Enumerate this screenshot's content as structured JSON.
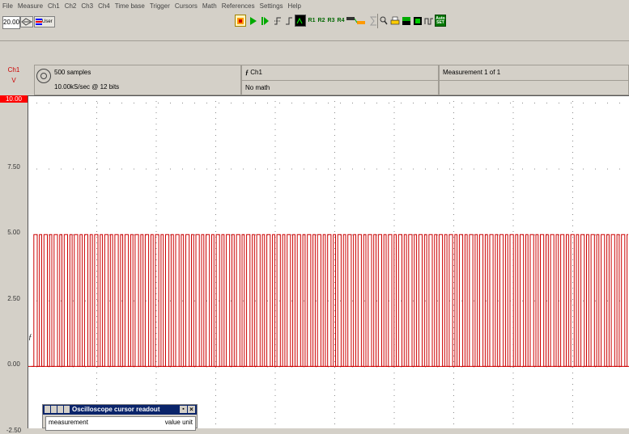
{
  "menu": [
    "File",
    "Measure",
    "Ch1",
    "Ch2",
    "Ch3",
    "Ch4",
    "Time base",
    "Trigger",
    "Cursors",
    "Math",
    "References",
    "Settings",
    "Help"
  ],
  "toolbar": {
    "timebase_value": "20.00",
    "user_label": "User",
    "ref_labels": [
      "R1",
      "R2",
      "R3",
      "R4"
    ],
    "auto_set_label": "Auto\nSET"
  },
  "info": {
    "channel": "Ch1",
    "unit": "V",
    "samples": "500 samples",
    "rate": "10.00kS/sec @ 12 bits",
    "source": "Ch1",
    "math": "No math",
    "measurement": "Measurement 1 of 1"
  },
  "chart_data": {
    "type": "line",
    "series": [
      {
        "values": [
          0,
          0,
          5,
          5,
          5,
          0,
          0,
          5,
          5,
          0,
          0,
          5,
          5,
          5,
          0,
          0,
          5,
          5,
          0,
          0,
          5,
          5,
          5,
          0,
          0,
          5,
          5,
          0,
          0,
          5,
          5,
          5,
          0,
          0,
          5,
          5,
          0,
          0,
          5,
          5,
          5,
          0,
          0,
          5,
          5,
          0,
          0,
          5,
          5,
          5,
          0,
          0,
          5,
          5,
          0,
          0,
          5,
          5,
          5,
          0,
          0,
          5,
          5,
          0,
          0,
          5,
          5,
          5,
          0,
          0,
          5,
          5,
          0,
          0,
          5,
          5,
          5,
          0,
          0,
          5,
          5,
          0,
          0,
          5,
          5,
          5,
          0,
          0,
          5,
          5,
          0,
          0,
          5,
          5,
          5,
          0,
          0,
          5,
          5,
          0,
          0,
          5,
          5,
          5,
          0,
          0,
          5,
          5,
          0,
          0,
          5,
          5,
          5,
          0,
          0,
          5,
          5,
          0,
          0,
          5,
          5,
          5,
          0,
          0,
          5,
          5,
          0,
          0,
          5,
          5,
          5,
          0,
          0,
          5,
          5,
          0,
          0,
          5,
          5,
          5,
          0,
          0,
          5,
          5,
          0,
          0,
          5,
          5,
          5,
          0,
          0,
          5,
          5,
          0,
          0,
          5,
          5,
          5,
          0,
          0,
          5,
          5,
          0,
          0,
          5,
          5,
          5,
          0,
          0,
          5,
          5,
          0,
          0,
          5,
          5,
          5,
          0,
          0,
          5,
          5,
          0,
          0,
          5,
          5,
          5,
          0,
          0,
          5,
          5,
          0,
          0,
          5,
          5,
          5,
          0,
          0,
          5,
          5,
          0,
          0,
          5,
          5,
          5,
          0,
          0,
          5,
          5,
          0,
          0,
          5,
          5,
          5,
          0,
          0,
          5,
          5,
          0,
          0,
          5,
          5,
          5,
          0,
          0,
          5,
          5,
          0,
          0,
          5,
          5,
          5,
          0,
          0,
          5,
          5,
          0,
          0,
          5,
          5,
          5,
          0,
          0,
          5,
          5,
          0,
          0,
          5,
          5,
          5,
          0,
          0,
          5,
          5,
          0,
          0,
          5,
          5,
          5,
          0,
          0,
          5,
          5,
          0,
          0,
          5,
          5,
          5,
          0,
          0,
          5,
          5,
          0,
          0,
          5,
          5,
          5,
          0,
          0,
          5,
          5,
          0,
          0,
          5,
          5,
          5,
          0,
          0,
          5,
          5,
          0,
          0,
          5,
          5,
          5,
          0,
          0,
          5,
          5,
          0,
          0,
          5,
          5,
          5,
          0,
          0,
          5,
          5,
          0,
          0,
          5,
          5,
          5,
          0,
          0,
          5,
          5,
          0,
          0,
          5,
          5,
          5,
          0,
          0,
          5,
          5,
          0,
          0,
          5,
          5,
          5,
          0,
          0,
          5,
          5,
          0,
          0,
          5,
          5,
          5,
          0,
          0,
          5,
          5,
          0,
          0,
          5,
          5,
          5,
          0,
          0,
          5,
          5,
          0,
          0,
          5,
          5,
          5,
          0,
          0,
          5,
          5,
          0,
          0,
          5,
          5,
          5,
          0,
          0,
          5,
          5,
          0,
          0,
          5,
          5,
          5,
          0,
          0,
          5,
          5,
          0,
          0,
          5,
          5,
          5,
          0,
          0,
          5,
          5,
          0,
          0,
          5,
          5,
          5,
          0,
          0,
          5,
          5,
          0,
          0,
          5,
          5,
          5,
          0,
          0,
          5,
          5,
          0,
          0,
          5,
          5,
          5,
          0,
          0,
          5,
          5,
          0,
          0,
          5,
          5,
          5,
          0,
          0,
          5,
          5,
          0,
          0,
          5,
          5,
          5,
          0,
          0,
          5,
          5,
          0,
          0,
          5,
          5,
          5,
          0,
          0,
          5,
          5,
          0,
          0,
          5,
          5,
          5,
          0,
          0,
          5,
          5,
          0,
          0,
          5,
          5,
          5,
          0,
          0,
          5,
          5,
          0,
          0,
          5,
          5,
          5,
          0,
          0,
          5,
          5,
          0,
          0,
          5,
          5,
          5,
          0,
          0,
          5,
          5,
          0,
          0,
          5,
          5,
          5,
          0,
          0,
          5,
          5,
          0,
          0,
          5,
          5,
          5,
          0,
          0,
          5,
          5,
          0,
          0,
          5,
          5,
          5,
          0,
          0,
          5,
          5,
          0,
          0,
          5,
          5,
          5,
          0,
          0,
          5,
          5,
          0,
          0,
          5,
          5,
          5,
          0,
          0,
          5,
          5,
          0,
          0,
          5,
          5,
          5,
          0,
          0,
          5,
          5
        ],
        "color": "#cc0000"
      }
    ],
    "ylabel": "Ch1 V",
    "y_ticks": [
      "10.00",
      "7.50",
      "5.00",
      "2.50",
      "0.00",
      "-2.50"
    ],
    "ylim": [
      -2.5,
      10
    ],
    "grid": true
  },
  "readout": {
    "title": "Oscilloscope cursor readout",
    "col_measurement": "measurement",
    "col_value_unit": "value unit"
  }
}
